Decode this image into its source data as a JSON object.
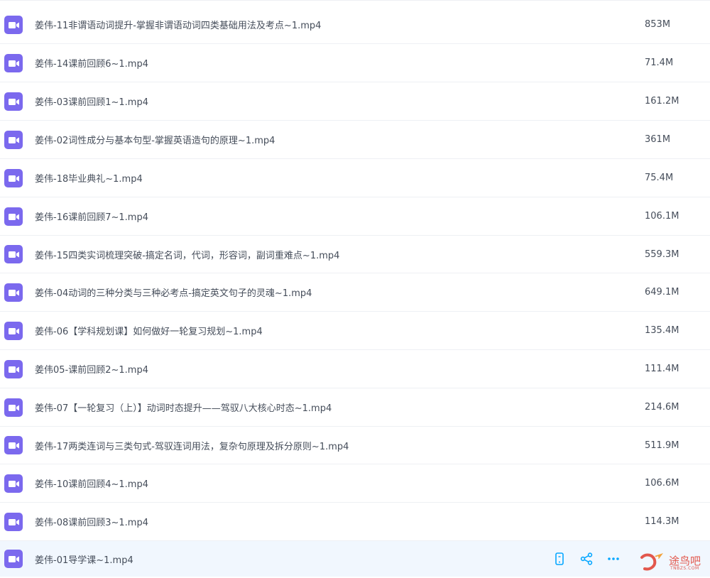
{
  "files": [
    {
      "name": "姜伟-11非谓语动词提升-掌握非谓语动词四类基础用法及考点~1.mp4",
      "size": "853M",
      "icon": "video-file-icon"
    },
    {
      "name": "姜伟-14课前回顾6~1.mp4",
      "size": "71.4M",
      "icon": "video-file-icon"
    },
    {
      "name": "姜伟-03课前回顾1~1.mp4",
      "size": "161.2M",
      "icon": "video-file-icon"
    },
    {
      "name": "姜伟-02词性成分与基本句型-掌握英语造句的原理~1.mp4",
      "size": "361M",
      "icon": "video-file-icon"
    },
    {
      "name": "姜伟-18毕业典礼~1.mp4",
      "size": "75.4M",
      "icon": "video-file-icon"
    },
    {
      "name": "姜伟-16课前回顾7~1.mp4",
      "size": "106.1M",
      "icon": "video-file-icon"
    },
    {
      "name": "姜伟-15四类实词梳理突破-搞定名词，代词，形容词，副词重难点~1.mp4",
      "size": "559.3M",
      "icon": "video-file-icon"
    },
    {
      "name": "姜伟-04动词的三种分类与三种必考点-搞定英文句子的灵魂~1.mp4",
      "size": "649.1M",
      "icon": "video-file-icon"
    },
    {
      "name": "姜伟-06【学科规划课】如何做好一轮复习规划~1.mp4",
      "size": "135.4M",
      "icon": "video-file-icon"
    },
    {
      "name": "姜伟05-课前回顾2~1.mp4",
      "size": "111.4M",
      "icon": "video-file-icon"
    },
    {
      "name": "姜伟-07【一轮复习（上）】动词时态提升——驾驭八大核心时态~1.mp4",
      "size": "214.6M",
      "icon": "video-file-icon"
    },
    {
      "name": "姜伟-17两类连词与三类句式-驾驭连词用法，复杂句原理及拆分原则~1.mp4",
      "size": "511.9M",
      "icon": "video-file-icon"
    },
    {
      "name": "姜伟-10课前回顾4~1.mp4",
      "size": "106.6M",
      "icon": "video-file-icon"
    },
    {
      "name": "姜伟-08课前回顾3~1.mp4",
      "size": "114.3M",
      "icon": "video-file-icon"
    },
    {
      "name": "姜伟-01导学课~1.mp4",
      "size": "",
      "icon": "video-file-icon",
      "selected": true
    }
  ],
  "row_actions": [
    {
      "icon": "phone-icon"
    },
    {
      "icon": "share-icon"
    },
    {
      "icon": "more-icon"
    }
  ],
  "watermark": {
    "text": "途鸟吧",
    "sub": "TNBZS.COM"
  },
  "colors": {
    "icon_purple": "#7b69ee",
    "action_blue": "#06a7ff",
    "selected_bg": "#f1f7fe",
    "text": "#454d5a",
    "watermark_red": "#e2574c"
  }
}
